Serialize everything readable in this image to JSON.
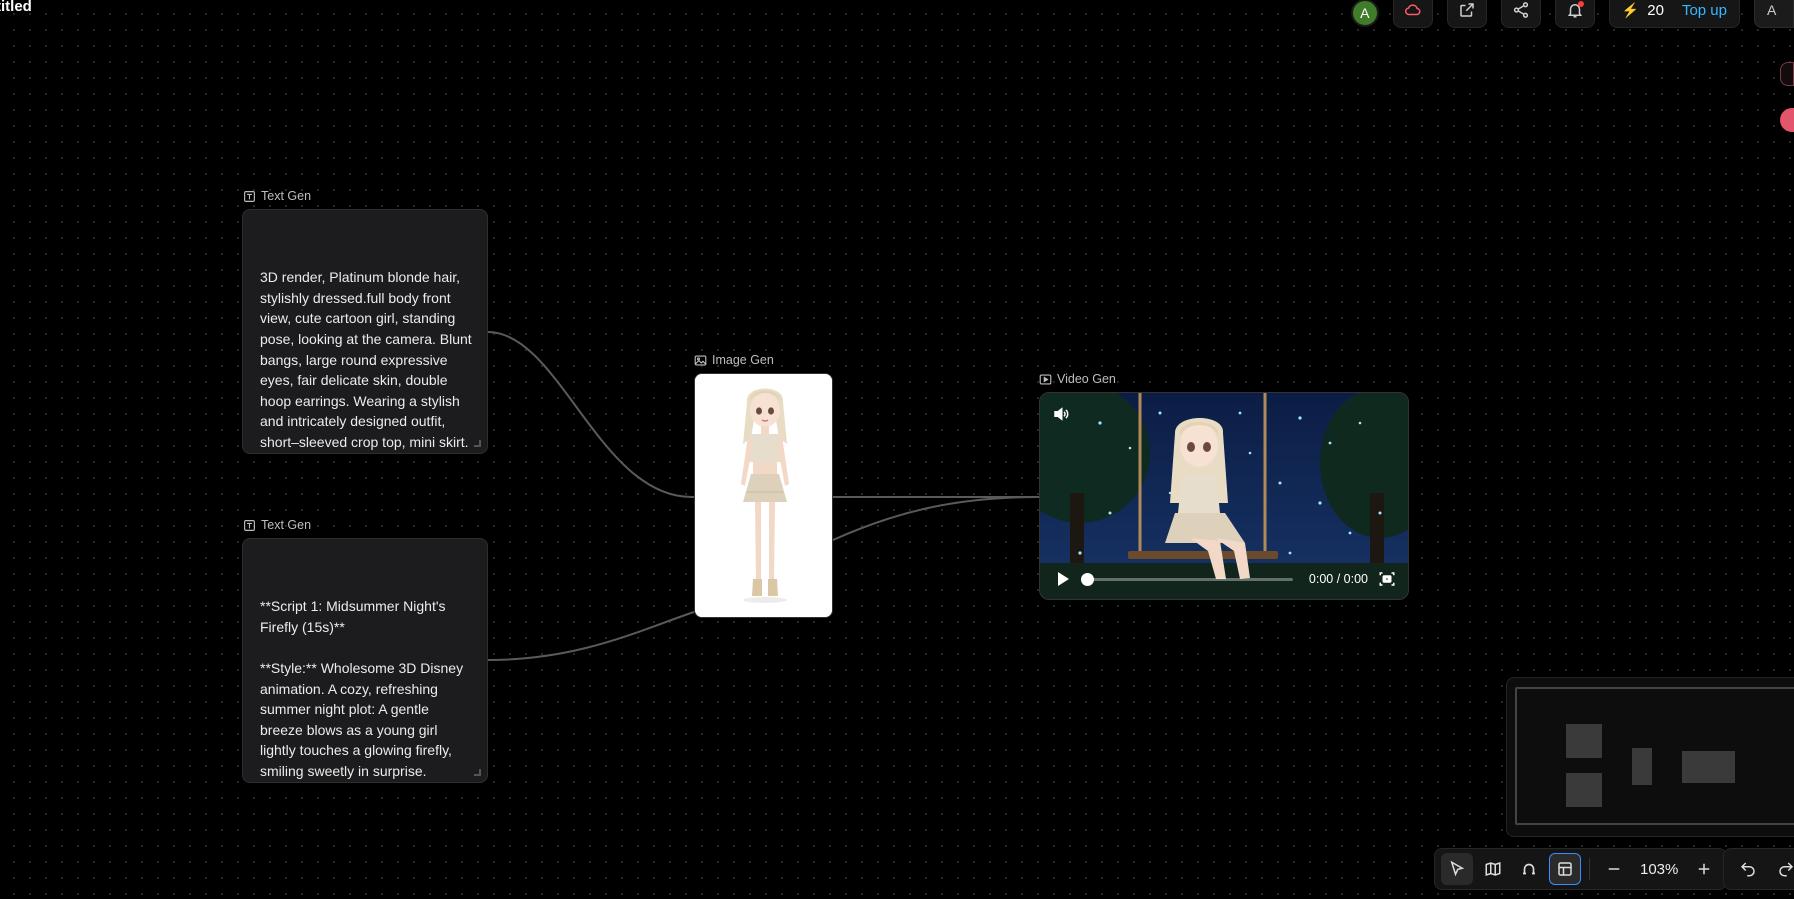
{
  "document": {
    "title": "titled"
  },
  "topbar": {
    "user_avatar_initial": "A",
    "credits": "20",
    "top_up_label": "Top up",
    "edge_avatar_initial": "A"
  },
  "nodes": {
    "text_gen_1": {
      "label": "Text Gen",
      "content": "3D render, Platinum blonde hair, stylishly dressed.full body front view, cute cartoon girl, standing pose, looking at the camera. Blunt bangs, large round expressive eyes, fair delicate skin, double hoop earrings. Wearing a stylish and intricately designed outfit, short–sleeved crop top, mini skirt. Hyper–"
    },
    "text_gen_2": {
      "label": "Text Gen",
      "content": "**Script 1: Midsummer Night's Firefly (15s)**\n\n**Style:** Wholesome 3D Disney animation. A cozy, refreshing summer night plot: A gentle breeze blows as a young girl lightly touches a glowing firefly, smiling sweetly in surprise."
    },
    "image_gen": {
      "label": "Image Gen"
    },
    "video_gen": {
      "label": "Video Gen",
      "time_display": "0:00 / 0:00",
      "progress": 0
    }
  },
  "toolbar": {
    "zoom": "103%"
  },
  "colors": {
    "accent_blue": "#38b6ff",
    "avatar_green": "#3f7d2a",
    "notification_red": "#ff3b3b"
  }
}
